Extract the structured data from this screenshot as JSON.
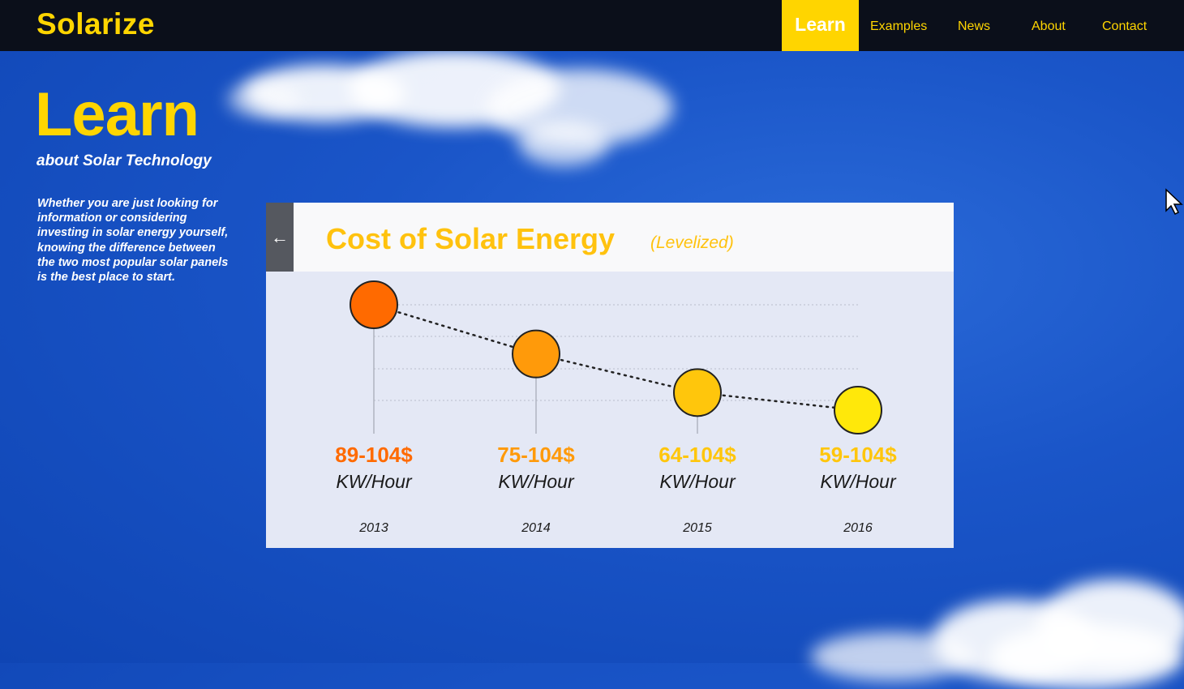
{
  "brand": "Solarize",
  "nav": {
    "items": [
      "Learn",
      "Examples",
      "News",
      "About",
      "Contact"
    ],
    "active": "Learn"
  },
  "hero": {
    "title": "Learn",
    "subtitle": "about Solar Technology",
    "body": "Whether you are just looking for information or considering investing in solar energy yourself, knowing the difference between the two most popular solar panels is the best place to start."
  },
  "card": {
    "back_icon": "arrow-left-icon",
    "title": "Cost of Solar Energy",
    "subtitle": "(Levelized)"
  },
  "chart_data": {
    "type": "line",
    "title": "Cost of Solar Energy",
    "subtitle": "(Levelized)",
    "x": [
      "2013",
      "2014",
      "2015",
      "2016"
    ],
    "series": [
      {
        "values": [
          89,
          75,
          64,
          59
        ]
      }
    ],
    "value_labels": [
      "89-104$",
      "75-104$",
      "64-104$",
      "59-104$"
    ],
    "unit_label": "KW/Hour",
    "point_colors": [
      "#ff6a00",
      "#ff9a0a",
      "#ffc60c",
      "#ffe80a"
    ],
    "grid": true
  },
  "colors": {
    "accent": "#ffd500",
    "nav_bg": "#0b0f1a",
    "sky": "#1a55c8",
    "card_bg": "#e4e8f5"
  }
}
